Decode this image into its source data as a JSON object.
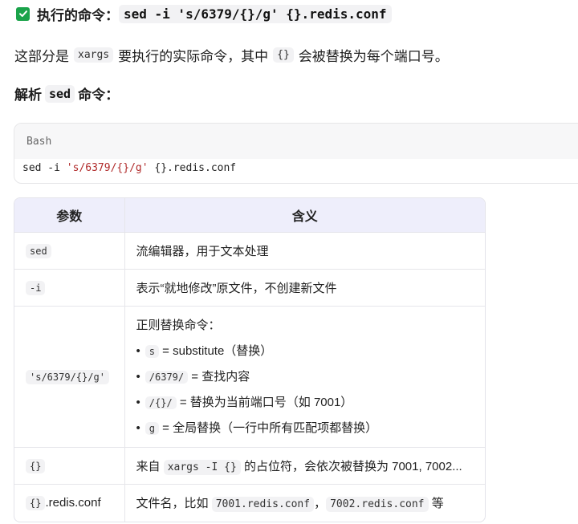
{
  "heading1": {
    "prefix": "执行的命令：",
    "command": "sed -i 's/6379/{}/g' {}.redis.conf"
  },
  "intro": {
    "part1": "这部分是",
    "code1": "xargs",
    "part2": "要执行的实际命令，其中",
    "code2": "{}",
    "part3": "会被替换为每个端口号。"
  },
  "heading2": {
    "prefix": "解析",
    "code": "sed",
    "suffix": "命令："
  },
  "codeblock": {
    "lang": "Bash",
    "cmd_start": "sed -i ",
    "cmd_str": "'s/6379/{}/g'",
    "cmd_end": " {}.redis.conf"
  },
  "table": {
    "headers": [
      "参数",
      "含义"
    ],
    "rows": [
      {
        "param": "sed",
        "meaning": "流编辑器，用于文本处理"
      },
      {
        "param": "-i",
        "meaning": "表示“就地修改”原文件，不创建新文件"
      },
      {
        "param": "'s/6379/{}/g'",
        "intro": "正则替换命令：",
        "bullets": [
          {
            "code": "s",
            "text": "= substitute（替换）"
          },
          {
            "code": "/6379/",
            "text": "= 查找内容"
          },
          {
            "code": "/{}/",
            "text": "= 替换为当前端口号（如 7001）"
          },
          {
            "code": "g",
            "text": "= 全局替换（一行中所有匹配项都替换）"
          }
        ]
      },
      {
        "param": "{}",
        "m1": "来自",
        "mcode": "xargs -I {}",
        "m2": "的占位符，会依次被替换为 7001, 7002..."
      },
      {
        "param": "{}",
        "param_suffix": ".redis.conf",
        "m1": "文件名，比如",
        "mcode1": "7001.redis.conf",
        "msep": "，",
        "mcode2": "7002.redis.conf",
        "m2": "等"
      }
    ]
  }
}
